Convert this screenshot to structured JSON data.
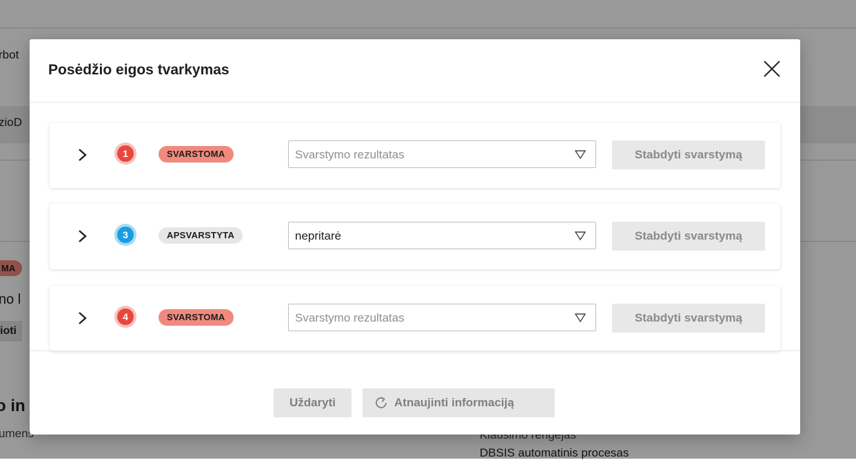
{
  "background": {
    "frag_1": "rbot",
    "frag_2": "zioD",
    "badge_frag": "MA",
    "frag_3": "no l",
    "btn_frag": "ioti",
    "frag_4": "o in",
    "frag_5": "umens",
    "frag_6": "Klausimo rengėjas",
    "frag_7": "DBSIS automatinis procesas"
  },
  "modal": {
    "title": "Posėdžio eigos tvarkymas",
    "close_icon": "close-icon",
    "items": [
      {
        "number": "1",
        "number_color": "#e8473d",
        "status": "SVARSTOMA",
        "status_color": "#f08a7e",
        "select_placeholder": "Svarstymo rezultatas",
        "select_value": "",
        "stop_label": "Stabdyti svarstymą"
      },
      {
        "number": "3",
        "number_color": "#1a9ee0",
        "status": "APSVARSTYTA",
        "status_color": "#e6e6e6",
        "select_placeholder": "Svarstymo rezultatas",
        "select_value": "nepritarė",
        "stop_label": "Stabdyti svarstymą"
      },
      {
        "number": "4",
        "number_color": "#e8473d",
        "status": "SVARSTOMA",
        "status_color": "#f08a7e",
        "select_placeholder": "Svarstymo rezultatas",
        "select_value": "",
        "stop_label": "Stabdyti svarstymą"
      }
    ],
    "footer": {
      "close_label": "Uždaryti",
      "refresh_label": "Atnaujinti informaciją",
      "refresh_icon": "refresh-icon"
    }
  }
}
